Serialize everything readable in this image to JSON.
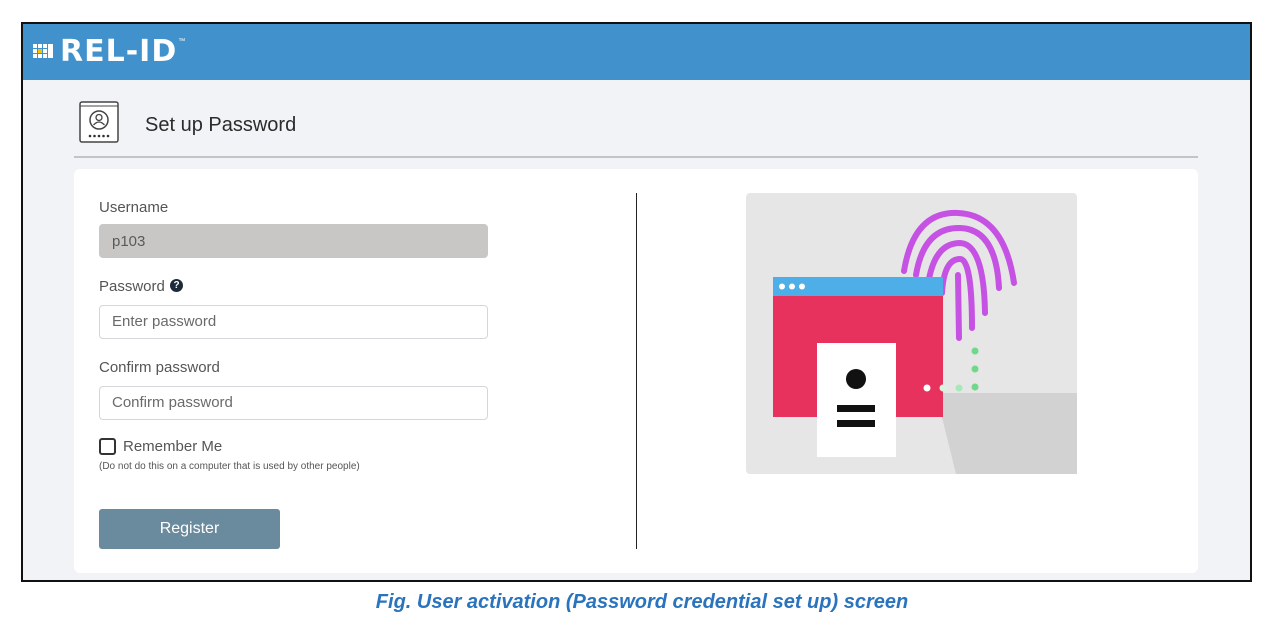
{
  "app": {
    "logo_text": "REL-ID",
    "logo_tm": "™"
  },
  "header": {
    "title": "Set up Password",
    "icon": "password-setup-icon"
  },
  "form": {
    "username_label": "Username",
    "username_value": "p103",
    "password_label": "Password",
    "password_placeholder": "Enter password",
    "confirm_label": "Confirm password",
    "confirm_placeholder": "Confirm password",
    "remember_label": "Remember Me",
    "remember_hint": "(Do not do this on a computer that is used by other people)",
    "remember_checked": false,
    "register_label": "Register"
  },
  "illustration": {
    "name": "fingerprint-login-illustration"
  },
  "caption": "Fig. User activation (Password credential set up) screen",
  "colors": {
    "topbar": "#4191cd",
    "button": "#6a8a9d",
    "caption": "#2a73bd",
    "window_red": "#e6325c",
    "window_bar": "#4daee8",
    "fingerprint": "#c652e4",
    "dots_green": "#6fd88a"
  }
}
